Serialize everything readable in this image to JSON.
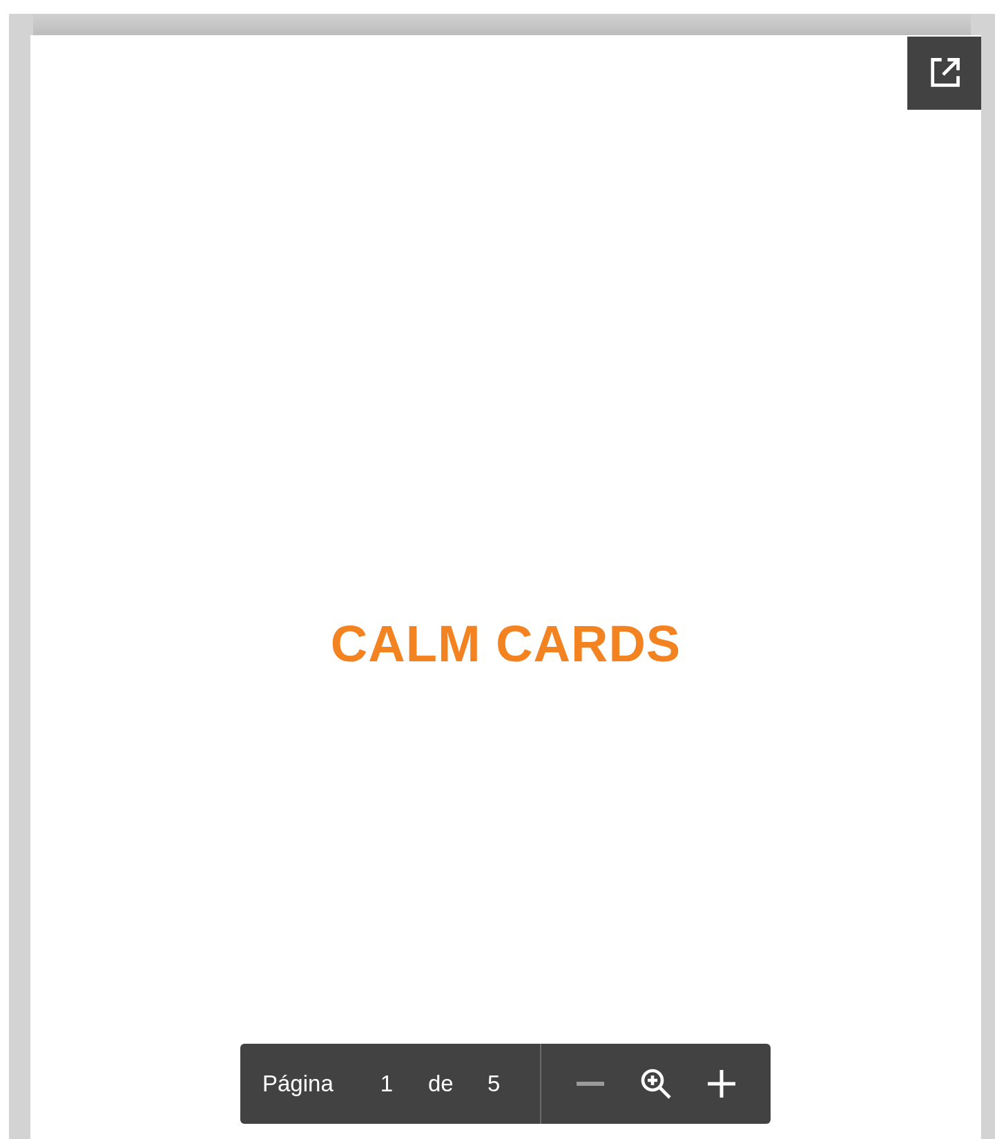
{
  "document": {
    "title_text": "CALM CARDS"
  },
  "toolbar": {
    "page_label": "Página",
    "current_page": "1",
    "of_label": "de",
    "total_pages": "5",
    "zoom_out": {
      "disabled": true
    },
    "zoom_in": {
      "disabled": false
    }
  }
}
